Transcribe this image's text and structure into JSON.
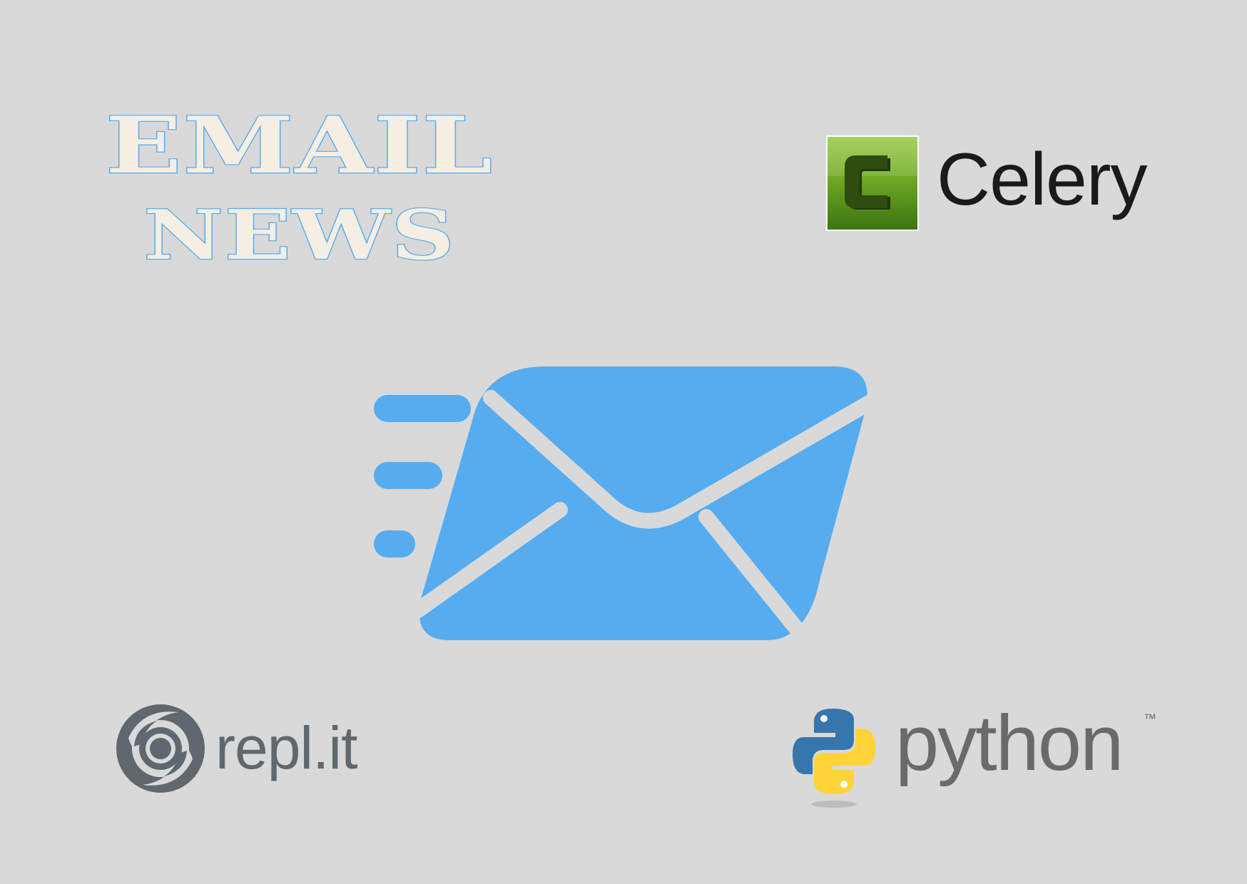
{
  "title": {
    "line1": "EMAIL",
    "line2": "NEWS"
  },
  "logos": {
    "celery": {
      "icon_letter": "C",
      "text": "Celery",
      "icon": "celery-icon"
    },
    "replit": {
      "text": "repl.it",
      "icon": "replit-icon"
    },
    "python": {
      "text": "python",
      "trademark": "™",
      "icon": "python-icon"
    }
  },
  "illustration": {
    "icon": "email-envelope-icon",
    "speed_lines": 3
  },
  "colors": {
    "background": "#d9d9d9",
    "envelope": "#56acef",
    "title_fill": "#f4efe2",
    "title_outline": "#5aaaeb",
    "celery_green": "#66a020",
    "python_blue": "#3776ab",
    "python_yellow": "#ffd43b",
    "replit_gray": "#5f686e"
  }
}
